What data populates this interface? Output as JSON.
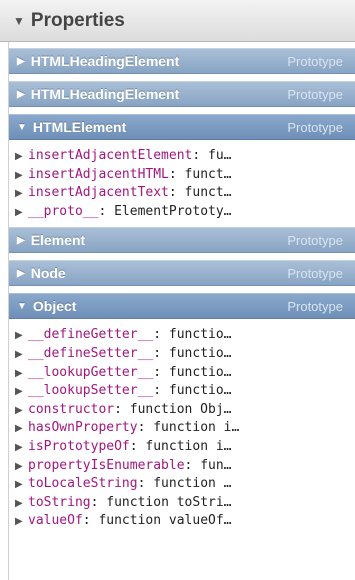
{
  "section": {
    "title": "Properties",
    "toggle": "▼"
  },
  "groups": [
    {
      "name": "HTMLHeadingElement",
      "tag": "Prototype",
      "expanded": false,
      "toggle": "▶",
      "rows": []
    },
    {
      "name": "HTMLHeadingElement",
      "tag": "Prototype",
      "expanded": false,
      "toggle": "▶",
      "rows": []
    },
    {
      "name": "HTMLElement",
      "tag": "Prototype",
      "expanded": true,
      "toggle": "▼",
      "rows": [
        {
          "key": "insertAdjacentElement",
          "val": ": fu…"
        },
        {
          "key": "insertAdjacentHTML",
          "val": ": funct…"
        },
        {
          "key": "insertAdjacentText",
          "val": ": funct…"
        },
        {
          "key": "__proto__",
          "val": ": ElementPrototy…"
        }
      ]
    },
    {
      "name": "Element",
      "tag": "Prototype",
      "expanded": false,
      "toggle": "▶",
      "rows": []
    },
    {
      "name": "Node",
      "tag": "Prototype",
      "expanded": false,
      "toggle": "▶",
      "rows": []
    },
    {
      "name": "Object",
      "tag": "Prototype",
      "expanded": true,
      "toggle": "▼",
      "rows": [
        {
          "key": "__defineGetter__",
          "val": ": functio…"
        },
        {
          "key": "__defineSetter__",
          "val": ": functio…"
        },
        {
          "key": "__lookupGetter__",
          "val": ": functio…"
        },
        {
          "key": "__lookupSetter__",
          "val": ": functio…"
        },
        {
          "key": "constructor",
          "val": ": function Obj…"
        },
        {
          "key": "hasOwnProperty",
          "val": ": function i…"
        },
        {
          "key": "isPrototypeOf",
          "val": ": function i…"
        },
        {
          "key": "propertyIsEnumerable",
          "val": ": fun…"
        },
        {
          "key": "toLocaleString",
          "val": ": function …"
        },
        {
          "key": "toString",
          "val": ": function toStri…"
        },
        {
          "key": "valueOf",
          "val": ": function valueOf…"
        }
      ]
    }
  ],
  "icons": {
    "collapsed": "triangle-right-icon",
    "expanded": "triangle-down-icon"
  },
  "colors": {
    "bar_collapsed": "#98b2d0",
    "bar_expanded": "#7d9cc2",
    "property_key": "#a2167f",
    "property_value": "#222222"
  }
}
